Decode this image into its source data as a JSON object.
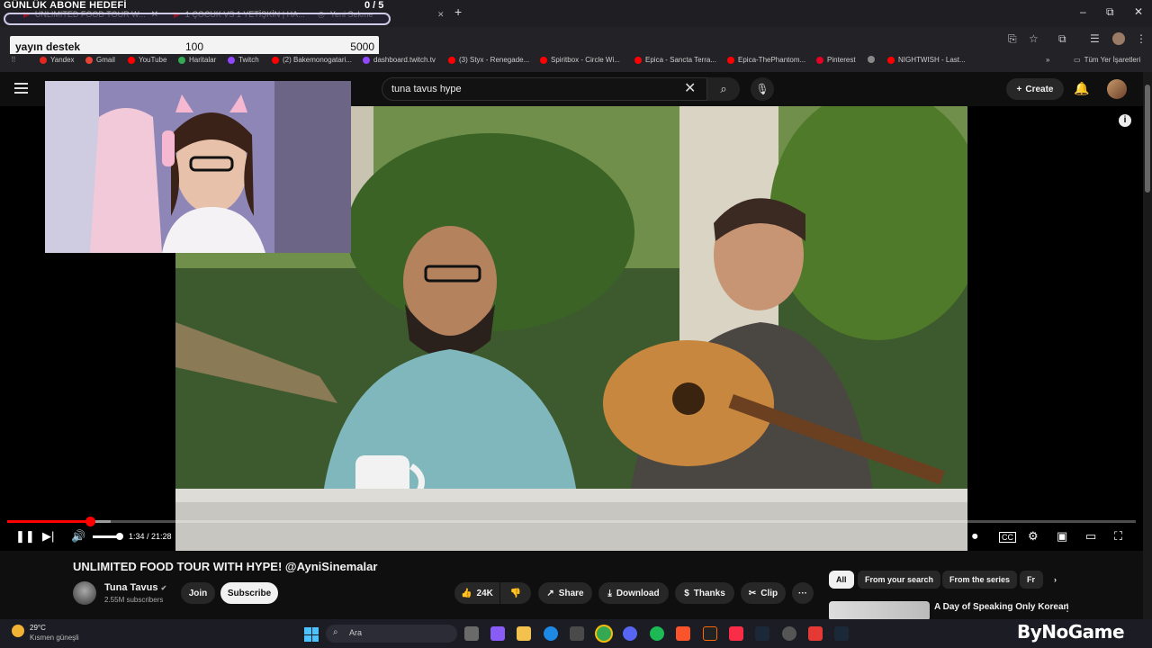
{
  "overlay": {
    "goal_title": "GÜNLÜK ABONE HEDEFİ",
    "goal_count": "0 / 5",
    "donate_name": "yayın destek",
    "donate_min": "100",
    "donate_max": "5000"
  },
  "browser": {
    "tabs": [
      {
        "label": "UNLIMITED FOOD TOUR W..."
      },
      {
        "label": "1 ÇOCUK VS 1 YETİŞKİN | HA..."
      },
      {
        "label": "Yeni Sekme"
      }
    ],
    "new_tab": "+",
    "window_controls": [
      "–",
      "⧉",
      "✕"
    ],
    "bookmarks": [
      {
        "label": "Yandex",
        "color": "#e52620"
      },
      {
        "label": "Gmail",
        "color": "#ea4335"
      },
      {
        "label": "YouTube",
        "color": "#ff0000"
      },
      {
        "label": "Haritalar",
        "color": "#34a853"
      },
      {
        "label": "Twitch",
        "color": "#9146ff"
      },
      {
        "label": "(2) Bakemonogatari...",
        "color": "#ff0000"
      },
      {
        "label": "dashboard.twitch.tv",
        "color": "#9146ff"
      },
      {
        "label": "(3) Styx - Renegade...",
        "color": "#ff0000"
      },
      {
        "label": "Spiritbox - Circle Wi...",
        "color": "#ff0000"
      },
      {
        "label": "Epica - Sancta Terra...",
        "color": "#ff0000"
      },
      {
        "label": "Epica-ThePhantom...",
        "color": "#ff0000"
      },
      {
        "label": "Pinterest",
        "color": "#e60023"
      },
      {
        "label": "",
        "color": "#888888"
      },
      {
        "label": "NIGHTWISH - Last...",
        "color": "#ff0000"
      }
    ],
    "all_bookmarks": "Tüm Yer İşaretleri"
  },
  "youtube": {
    "search_value": "tuna tavus hype",
    "create_label": "Create",
    "player": {
      "current_time": "1:34",
      "duration": "21:28",
      "time_display": "1:34 / 21:28",
      "played_fraction": 0.073,
      "loaded_fraction": 0.092,
      "volume_fraction": 1.0
    },
    "video_title": "UNLIMITED FOOD TOUR WITH HYPE! @AyniSinemalar",
    "channel_name": "Tuna Tavus",
    "verified": "✔",
    "subscribers": "2.55M subscribers",
    "join_label": "Join",
    "subscribe_label": "Subscribe",
    "like_count": "24K",
    "share_label": "Share",
    "download_label": "Download",
    "thanks_label": "Thanks",
    "clip_label": "Clip",
    "more_label": "···",
    "chips": [
      "All",
      "From your search",
      "From the series",
      "Fr"
    ],
    "rec_title": "A Day of Speaking Only Korean"
  },
  "taskbar": {
    "temp": "29°C",
    "weather": "Kısmen güneşli",
    "search_placeholder": "Ara"
  },
  "watermark": "ByNoGame"
}
